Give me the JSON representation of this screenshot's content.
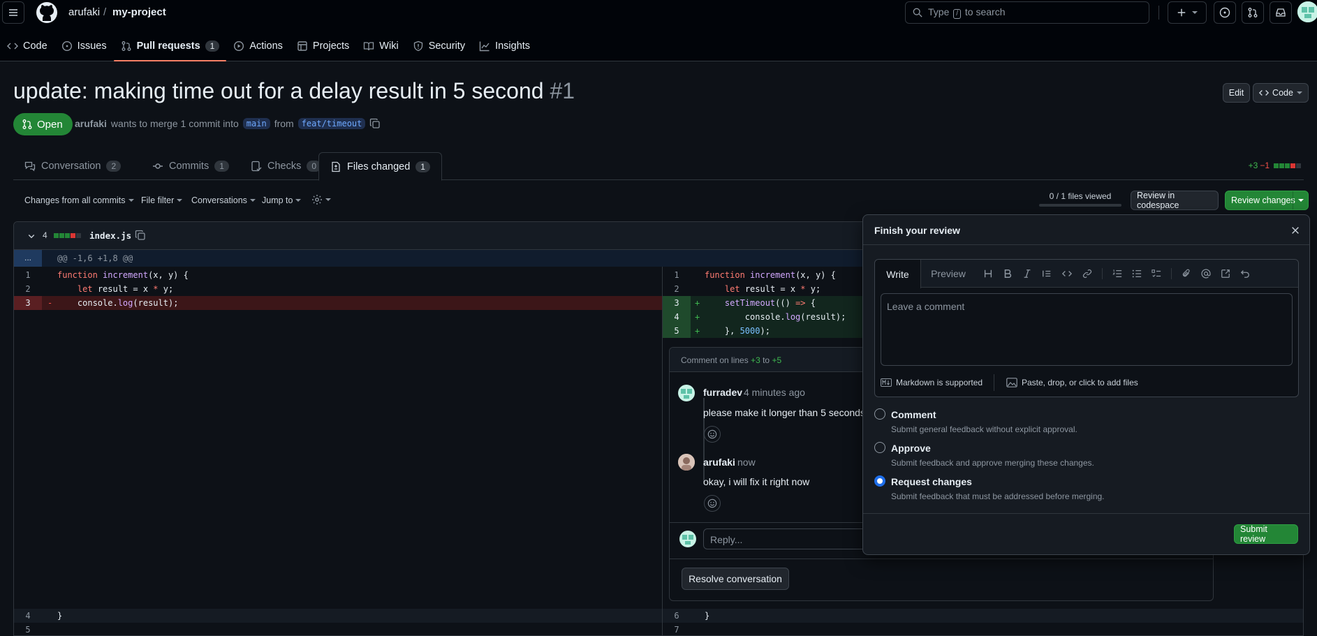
{
  "header": {
    "owner": "arufaki",
    "separator": "/",
    "repo": "my-project",
    "search_prefix": "Type",
    "search_key": "/",
    "search_suffix": "to search"
  },
  "nav": [
    {
      "label": "Code",
      "icon": "code-icon"
    },
    {
      "label": "Issues",
      "icon": "issue-icon"
    },
    {
      "label": "Pull requests",
      "icon": "pull-request-icon",
      "count": "1",
      "selected": true
    },
    {
      "label": "Actions",
      "icon": "play-icon"
    },
    {
      "label": "Projects",
      "icon": "table-icon"
    },
    {
      "label": "Wiki",
      "icon": "book-icon"
    },
    {
      "label": "Security",
      "icon": "shield-icon"
    },
    {
      "label": "Insights",
      "icon": "graph-icon"
    }
  ],
  "pr": {
    "title": "update: making time out for a delay result in 5 second",
    "number": "#1",
    "state": "Open",
    "author": "arufaki",
    "merge_text": "wants to merge 1 commit into",
    "base": "main",
    "from_text": "from",
    "head": "feat/timeout",
    "edit_label": "Edit",
    "code_label": "Code"
  },
  "tabs": [
    {
      "label": "Conversation",
      "count": "2"
    },
    {
      "label": "Commits",
      "count": "1"
    },
    {
      "label": "Checks",
      "count": "0"
    },
    {
      "label": "Files changed",
      "count": "1",
      "selected": true
    }
  ],
  "diffstat": {
    "added": "+3",
    "removed": "−1"
  },
  "toolbar": {
    "changes": "Changes from all commits",
    "file_filter": "File filter",
    "conversations": "Conversations",
    "jump_to": "Jump to",
    "files_viewed": "0 / 1 files viewed",
    "codespace": "Review in codespace",
    "review": "Review changes"
  },
  "file": {
    "changes": "4",
    "name": "index.js",
    "hunk": "@@ -1,6 +1,8 @@",
    "expand": "..."
  },
  "diff_left": [
    {
      "n": "1",
      "sign": "",
      "code": "function increment(x, y) {"
    },
    {
      "n": "2",
      "sign": "",
      "code": "    let result = x * y;"
    },
    {
      "n": "3",
      "sign": "-",
      "code": "    console.log(result);"
    }
  ],
  "diff_right": [
    {
      "n": "1",
      "sign": "",
      "code": "function increment(x, y) {"
    },
    {
      "n": "2",
      "sign": "",
      "code": "    let result = x * y;"
    },
    {
      "n": "3",
      "sign": "+",
      "code": "    setTimeout(() => {"
    },
    {
      "n": "4",
      "sign": "+",
      "code": "        console.log(result);"
    },
    {
      "n": "5",
      "sign": "+",
      "code": "    }, 5000);"
    }
  ],
  "diff_tail_left": [
    {
      "n": "4",
      "code": "}"
    },
    {
      "n": "5",
      "code": ""
    }
  ],
  "diff_tail_right": [
    {
      "n": "6",
      "code": "}"
    },
    {
      "n": "7",
      "code": ""
    }
  ],
  "thread": {
    "header_prefix": "Comment on lines",
    "from": "+3",
    "to_word": "to",
    "to": "+5",
    "comments": [
      {
        "author": "furradev",
        "time": "4 minutes ago",
        "body": "please make it longer than 5 seconds"
      },
      {
        "author": "arufaki",
        "time": "now",
        "body": "okay, i will fix it right now"
      }
    ],
    "reply_placeholder": "Reply...",
    "resolve": "Resolve conversation"
  },
  "review": {
    "title": "Finish your review",
    "write": "Write",
    "preview": "Preview",
    "placeholder": "Leave a comment",
    "markdown": "Markdown is supported",
    "attach": "Paste, drop, or click to add files",
    "options": [
      {
        "label": "Comment",
        "desc": "Submit general feedback without explicit approval.",
        "checked": false
      },
      {
        "label": "Approve",
        "desc": "Submit feedback and approve merging these changes.",
        "checked": false
      },
      {
        "label": "Request changes",
        "desc": "Submit feedback that must be addressed before merging.",
        "checked": true
      }
    ],
    "submit": "Submit review"
  },
  "colors": {
    "accent": "#f78166",
    "green": "#238636",
    "add_bg": "#12261e",
    "del_bg": "#3c1618",
    "blue": "#1f6feb"
  }
}
